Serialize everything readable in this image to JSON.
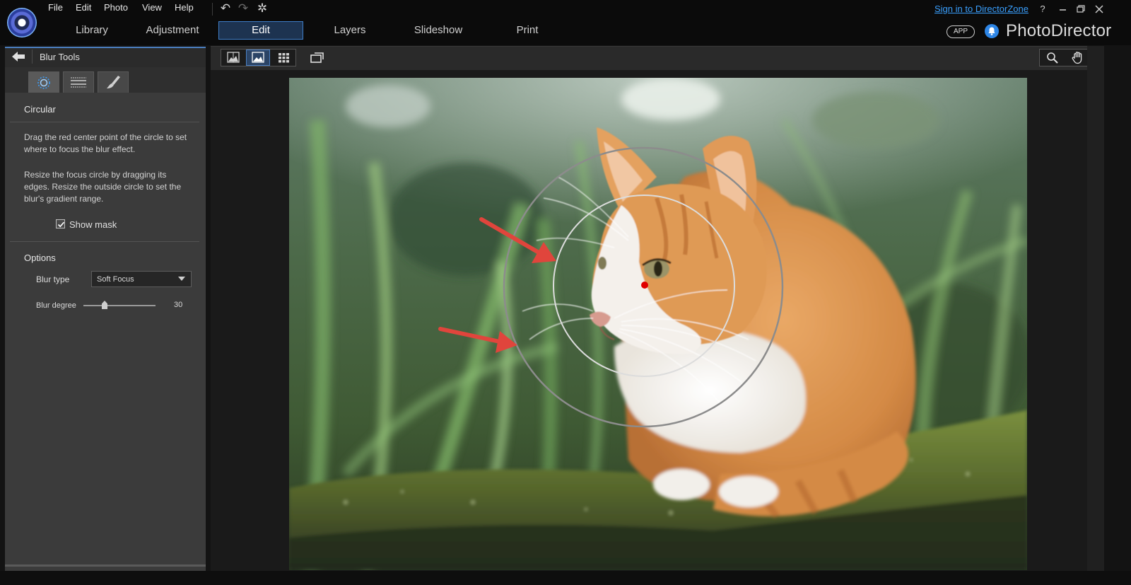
{
  "menu": {
    "items": [
      "File",
      "Edit",
      "Photo",
      "View",
      "Help"
    ]
  },
  "nav": {
    "tabs": [
      "Library",
      "Adjustment",
      "Edit",
      "Layers",
      "Slideshow",
      "Print"
    ],
    "active": "Edit"
  },
  "header_right": {
    "signin": "Sign in to DirectorZone",
    "help": "?",
    "app_badge": "APP",
    "brand": "PhotoDirector"
  },
  "panel": {
    "title": "Blur Tools",
    "tools": [
      "circular-blur-icon",
      "linear-blur-icon",
      "brush-icon"
    ],
    "section_title": "Circular",
    "desc1": "Drag the red center point of the circle to set where to focus the blur effect.",
    "desc2": "Resize the focus circle by dragging its edges. Resize the outside circle to set the blur's gradient range.",
    "show_mask": "Show mask",
    "show_mask_checked": true,
    "options_title": "Options",
    "blur_type_label": "Blur type",
    "blur_type_value": "Soft Focus",
    "blur_degree_label": "Blur degree",
    "blur_degree_value": "30"
  },
  "colors": {
    "accent": "#3f7ec8",
    "link": "#3aa0ff",
    "focus_point": "#e00000",
    "annotation_arrow": "#e0453c"
  }
}
